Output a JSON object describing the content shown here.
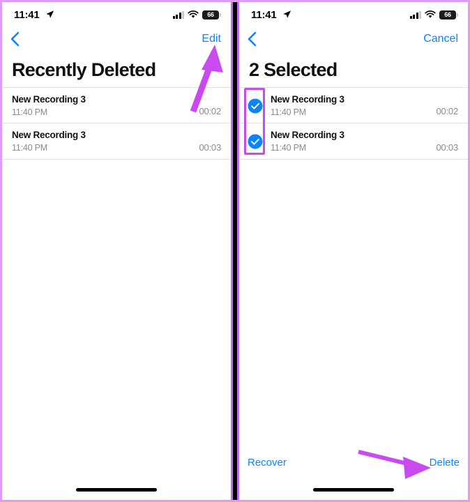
{
  "theme": {
    "accent_blue": "#0a84ff",
    "annotation_purple": "#c94bf0",
    "frame_purple": "#dd9cf7",
    "divider_black": "#000000",
    "text_primary": "#111114",
    "text_secondary": "#8a8a8e",
    "separator": "#e2e2e5",
    "check_blue": "#0a84ff"
  },
  "status_bar": {
    "time": "11:41",
    "location_icon": "location-arrow-icon",
    "signal_icon": "cellular-signal-icon",
    "wifi_icon": "wifi-icon",
    "battery_level": "66",
    "battery_icon": "battery-icon"
  },
  "left_panel": {
    "nav": {
      "back_icon": "chevron-left-icon",
      "action_label": "Edit"
    },
    "title": "Recently Deleted",
    "rows": [
      {
        "title": "New Recording 3",
        "time": "11:40 PM",
        "duration": "00:02",
        "selected": false
      },
      {
        "title": "New Recording 3",
        "time": "11:40 PM",
        "duration": "00:03",
        "selected": false
      }
    ],
    "annotation": {
      "type": "arrow",
      "points_to": "Edit",
      "color": "#c94bf0"
    }
  },
  "right_panel": {
    "nav": {
      "back_icon": "chevron-left-icon",
      "action_label": "Cancel"
    },
    "title": "2 Selected",
    "rows": [
      {
        "title": "New Recording 3",
        "time": "11:40 PM",
        "duration": "00:02",
        "selected": true
      },
      {
        "title": "New Recording 3",
        "time": "11:40 PM",
        "duration": "00:03",
        "selected": true
      }
    ],
    "toolbar": {
      "recover_label": "Recover",
      "delete_label": "Delete"
    },
    "annotations": [
      {
        "type": "highlight-rect",
        "target": "selection-checkboxes",
        "color": "#c94bf0"
      },
      {
        "type": "arrow",
        "points_to": "Delete",
        "color": "#c94bf0"
      }
    ]
  }
}
